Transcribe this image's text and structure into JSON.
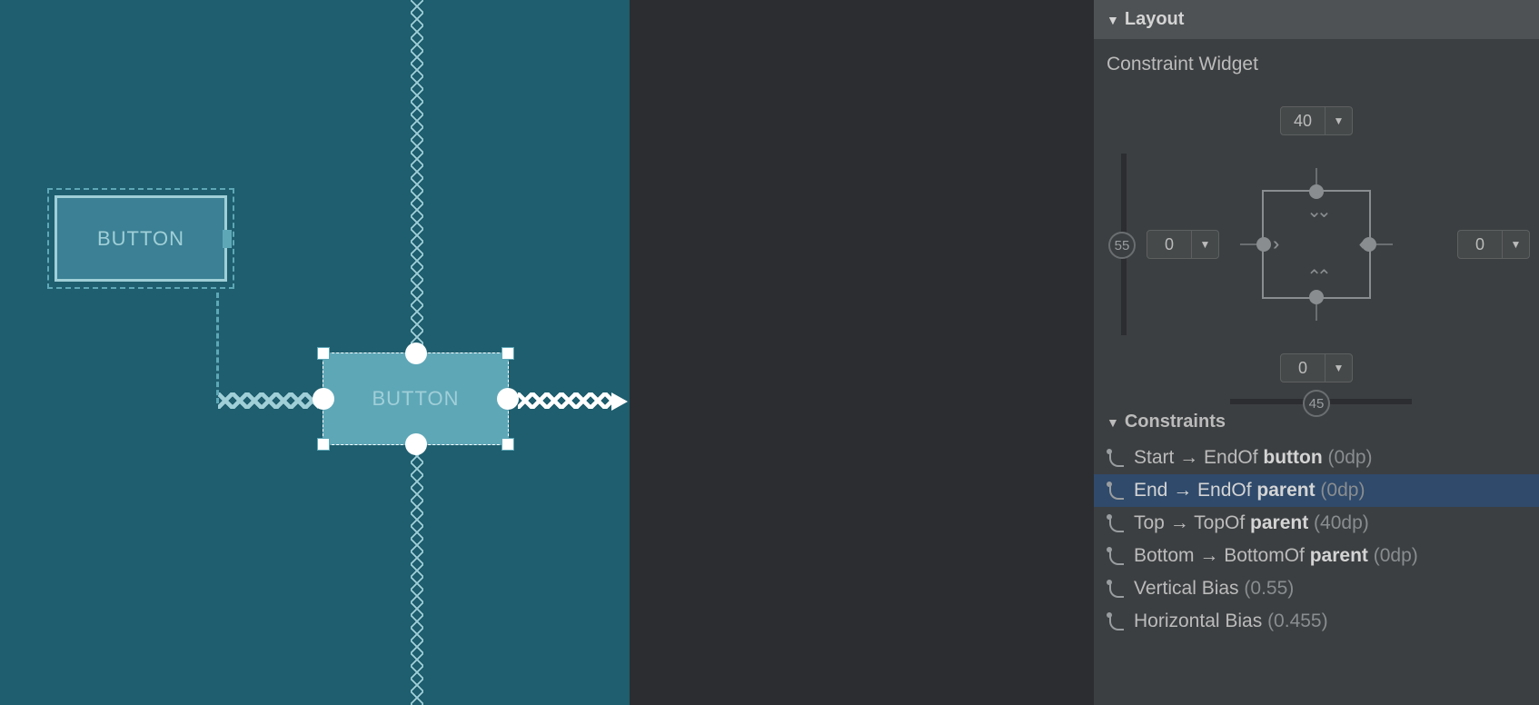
{
  "canvas": {
    "button1_label": "BUTTON",
    "button2_label": "BUTTON"
  },
  "inspector": {
    "layout_header": "Layout",
    "widget_title": "Constraint Widget",
    "margins": {
      "top": "40",
      "left": "0",
      "right": "0",
      "bottom": "0"
    },
    "bias": {
      "vertical": "55",
      "horizontal": "45"
    },
    "constraints_header": "Constraints",
    "constraints": [
      {
        "prefix": "Start → EndOf ",
        "target": "button",
        "suffix": " (0dp)",
        "selected": false
      },
      {
        "prefix": "End → EndOf ",
        "target": "parent",
        "suffix": " (0dp)",
        "selected": true
      },
      {
        "prefix": "Top → TopOf ",
        "target": "parent",
        "suffix": " (40dp)",
        "selected": false
      },
      {
        "prefix": "Bottom → BottomOf ",
        "target": "parent",
        "suffix": " (0dp)",
        "selected": false
      },
      {
        "prefix": "Vertical Bias",
        "target": "",
        "suffix": "   (0.55)",
        "selected": false
      },
      {
        "prefix": "Horizontal Bias",
        "target": "",
        "suffix": "   (0.455)",
        "selected": false
      }
    ]
  }
}
